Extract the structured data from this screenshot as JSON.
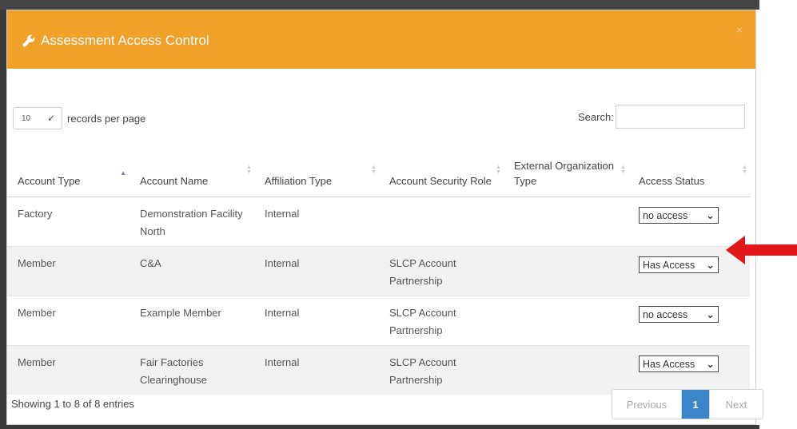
{
  "modal": {
    "title": "Assessment Access Control",
    "close_label": "×"
  },
  "controls": {
    "page_length": "10",
    "page_length_suffix": "records per page",
    "search_label": "Search:",
    "search_value": ""
  },
  "table": {
    "columns": [
      {
        "label": "Account Type"
      },
      {
        "label": "Account Name"
      },
      {
        "label": "Affiliation Type"
      },
      {
        "label": "Account Security Role"
      },
      {
        "label": "External Organization Type"
      },
      {
        "label": "Access Status"
      }
    ],
    "rows": [
      {
        "account_type": "Factory",
        "account_name": "Demonstration Facility North",
        "affiliation": "Internal",
        "role": "",
        "ext_org": "",
        "status": "no access"
      },
      {
        "account_type": "Member",
        "account_name": "C&A",
        "affiliation": "Internal",
        "role": "SLCP Account Partnership",
        "ext_org": "",
        "status": "Has Access"
      },
      {
        "account_type": "Member",
        "account_name": "Example Member",
        "affiliation": "Internal",
        "role": "SLCP Account Partnership",
        "ext_org": "",
        "status": "no access"
      },
      {
        "account_type": "Member",
        "account_name": "Fair Factories Clearinghouse",
        "affiliation": "Internal",
        "role": "SLCP Account Partnership",
        "ext_org": "",
        "status": "Has Access"
      }
    ]
  },
  "footer": {
    "info": "Showing 1 to 8 of 8 entries",
    "previous": "Previous",
    "current_page": "1",
    "next": "Next"
  },
  "colors": {
    "header": "#f0a12a",
    "pager_active": "#3a86c8",
    "annotation_arrow": "#e0181b"
  },
  "icons": [
    "wrench-icon",
    "close-icon",
    "chevron-down-icon",
    "sort-icon",
    "red-arrow-annotation"
  ]
}
